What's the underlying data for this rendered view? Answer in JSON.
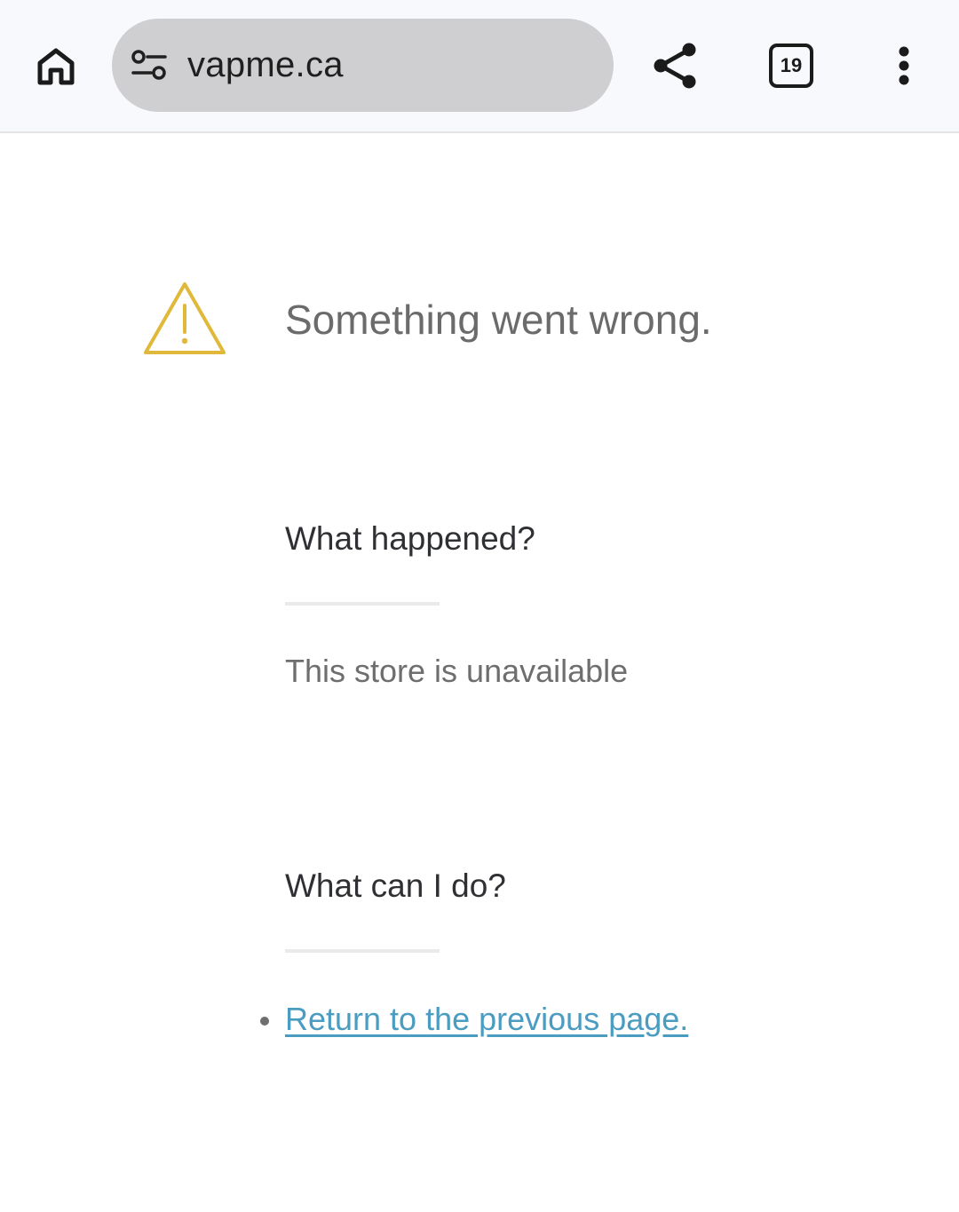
{
  "browser": {
    "url": "vapme.ca",
    "tab_count": "19",
    "icons": {
      "home": "home-icon",
      "site_settings": "tune-icon",
      "share": "share-icon",
      "tabs": "tab-switcher-icon",
      "menu": "more-vert-icon"
    }
  },
  "error_page": {
    "title": "Something went wrong.",
    "warning_icon": "warning-triangle-icon",
    "warning_color": "#e0b93a",
    "sections": [
      {
        "heading": "What happened?",
        "text": "This store is unavailable"
      },
      {
        "heading": "What can I do?",
        "link_text": "Return to the previous page."
      }
    ],
    "link_color": "#4a9cc0"
  }
}
